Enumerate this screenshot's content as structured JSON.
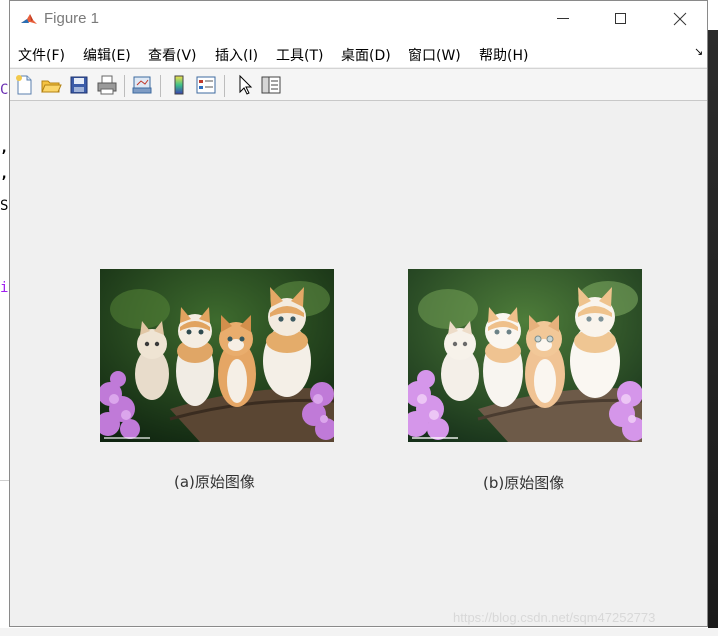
{
  "window": {
    "title": "Figure 1",
    "controls": {
      "minimize": "minimize",
      "maximize": "maximize",
      "close": "close"
    }
  },
  "menu": {
    "items": [
      {
        "label": "文件(F)"
      },
      {
        "label": "编辑(E)"
      },
      {
        "label": "查看(V)"
      },
      {
        "label": "插入(I)"
      },
      {
        "label": "工具(T)"
      },
      {
        "label": "桌面(D)"
      },
      {
        "label": "窗口(W)"
      },
      {
        "label": "帮助(H)"
      }
    ],
    "overflow_icon": "dock-arrow-icon"
  },
  "toolbar": {
    "buttons": [
      "new-figure-icon",
      "open-file-icon",
      "save-icon",
      "print-icon",
      "link-plot-icon",
      "insert-colorbar-icon",
      "insert-legend-icon",
      "pointer-icon",
      "property-inspector-icon"
    ]
  },
  "figure": {
    "subplots": [
      {
        "caption": "(a)原始图像",
        "image": "kittens-original"
      },
      {
        "caption": "(b)原始图像",
        "image": "kittens-processed"
      }
    ]
  },
  "watermark": "https://blog.csdn.net/sqm47252773",
  "background": {
    "fragments": [
      "C",
      ",",
      ",",
      "S",
      "i"
    ]
  },
  "colors": {
    "titlebar": "#ffffff",
    "canvas": "#f0f0f0",
    "accent": "#e8603c"
  }
}
